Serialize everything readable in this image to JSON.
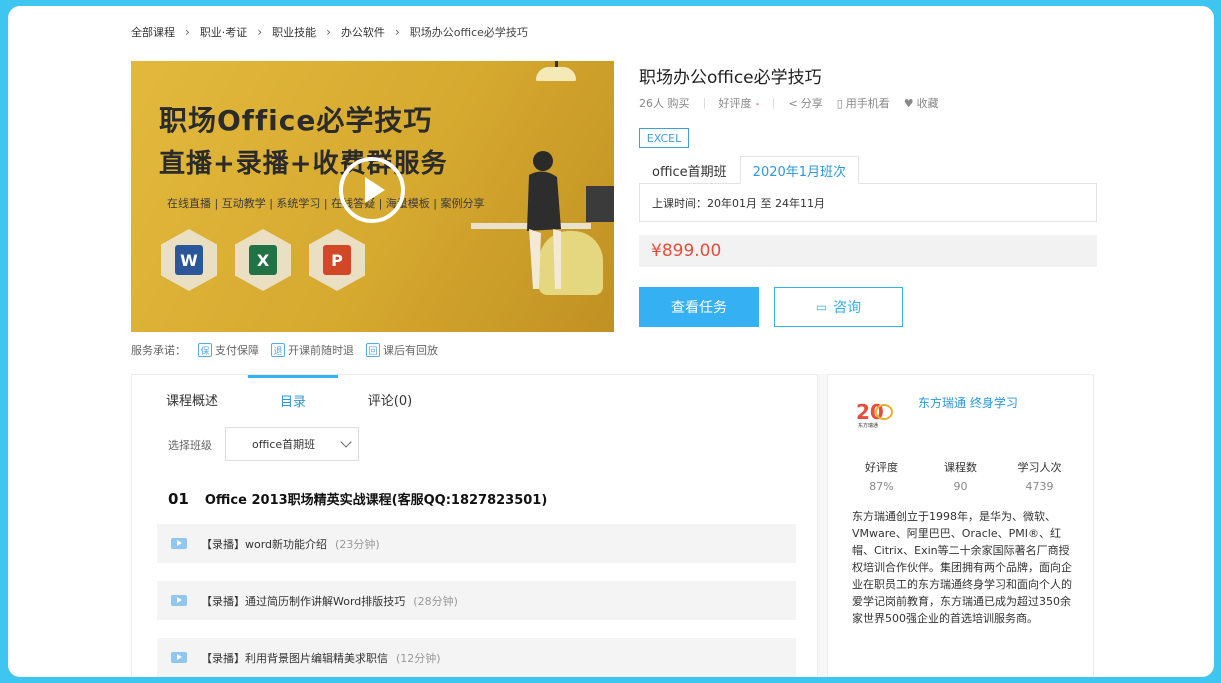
{
  "breadcrumb": [
    "全部课程",
    "职业·考证",
    "职业技能",
    "办公软件",
    "职场办公office必学技巧"
  ],
  "hero": {
    "headline1": "职场Office必学技巧",
    "headline2": "直播+录播+收费群服务",
    "tagline": "在线直播 | 互动教学 | 系统学习 | 在线答疑 | 海量模板 | 案例分享",
    "apps": [
      {
        "name": "word-icon",
        "letter": "W",
        "color": "#2b579a"
      },
      {
        "name": "excel-icon",
        "letter": "X",
        "color": "#217346"
      },
      {
        "name": "powerpoint-icon",
        "letter": "P",
        "color": "#d24726"
      }
    ]
  },
  "service": {
    "label": "服务承诺：",
    "items": [
      {
        "icon": "pay-guarantee-icon",
        "glyph": "保",
        "text": "支付保障"
      },
      {
        "icon": "refund-icon",
        "glyph": "退",
        "text": "开课前随时退"
      },
      {
        "icon": "replay-icon",
        "glyph": "回",
        "text": "课后有回放"
      }
    ]
  },
  "course": {
    "title": "职场办公office必学技巧",
    "buyers": "26人 购买",
    "rating_label": "好评度",
    "rating_value": "-",
    "share": "分享",
    "mobile": "用手机看",
    "favorite": "收藏",
    "tag": "EXCEL",
    "class_tabs": [
      "office首期班",
      "2020年1月班次"
    ],
    "schedule": "上课时间：20年01月 至 24年11月",
    "price": "¥899.00",
    "primary_button": "查看任务",
    "consult_button": "咨询"
  },
  "content": {
    "tabs": [
      "课程概述",
      "目录",
      "评论(0)"
    ],
    "select_label": "选择班级",
    "select_value": "office首期班",
    "chapter_num": "01",
    "chapter_title": "Office 2013职场精英实战课程(客服QQ:1827823501)",
    "lessons": [
      {
        "title": "【录播】word新功能介绍",
        "duration": "(23分钟)"
      },
      {
        "title": "【录播】通过简历制作讲解Word排版技巧",
        "duration": "(28分钟)"
      },
      {
        "title": "【录播】利用背景图片编辑精美求职信",
        "duration": "(12分钟)"
      }
    ]
  },
  "org": {
    "name": "东方瑞通 终身学习",
    "logo_text": "20",
    "logo_sub": "东方瑞通",
    "stats": [
      {
        "label": "好评度",
        "value": "87%"
      },
      {
        "label": "课程数",
        "value": "90"
      },
      {
        "label": "学习人次",
        "value": "4739"
      }
    ],
    "description": "东方瑞通创立于1998年，是华为、微软、VMware、阿里巴巴、Oracle、PMI®、红帽、Citrix、Exin等二十余家国际著名厂商授权培训合作伙伴。集团拥有两个品牌，面向企业在职员工的东方瑞通终身学习和面向个人的爱学记岗前教育，东方瑞通已成为超过350余家世界500强企业的首选培训服务商。"
  },
  "colors": {
    "accent": "#35b0f2",
    "price": "#e84c3d",
    "frame": "#3fc6f0"
  }
}
